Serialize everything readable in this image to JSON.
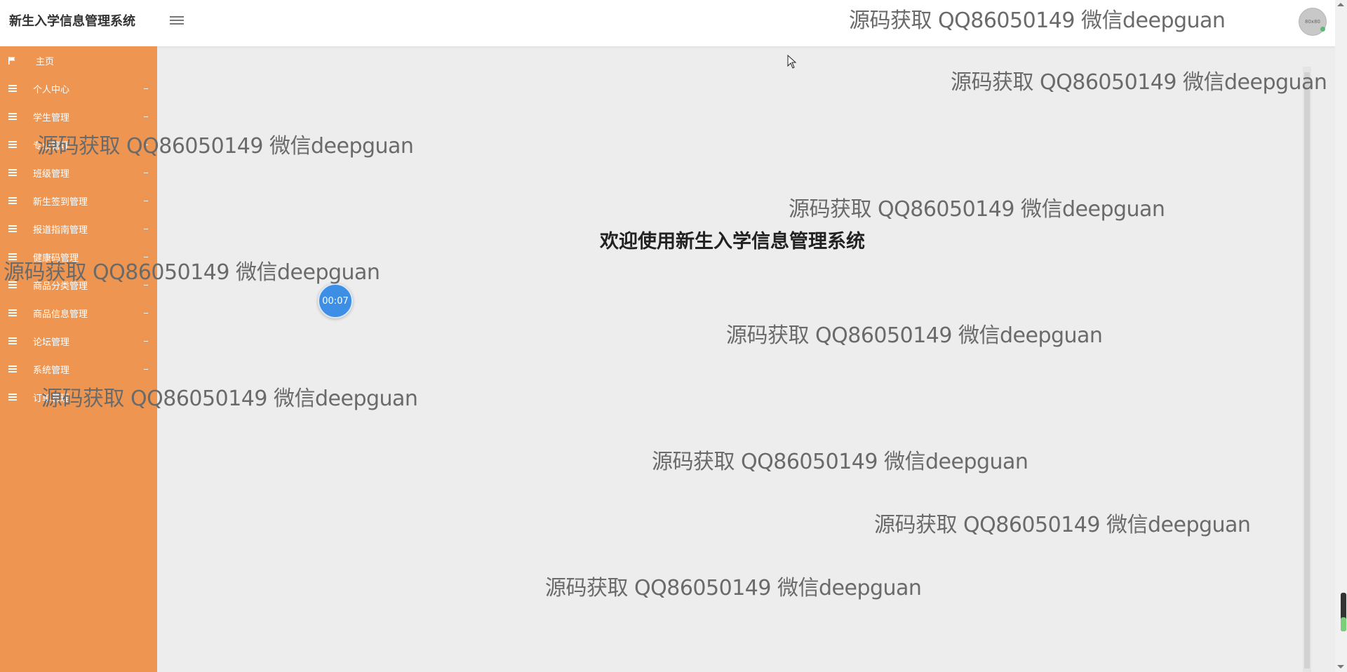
{
  "header": {
    "app_title": "新生入学信息管理系统",
    "menu_toggle_icon": "hamburger-icon",
    "avatar_text": "80x80"
  },
  "sidebar": {
    "items": [
      {
        "label": "主页",
        "icon": "flag-icon"
      },
      {
        "label": "个人中心",
        "icon": "list-icon"
      },
      {
        "label": "学生管理",
        "icon": "list-icon"
      },
      {
        "label": "专业管理",
        "icon": "list-icon"
      },
      {
        "label": "班级管理",
        "icon": "list-icon"
      },
      {
        "label": "新生签到管理",
        "icon": "list-icon"
      },
      {
        "label": "报道指南管理",
        "icon": "list-icon"
      },
      {
        "label": "健康码管理",
        "icon": "list-icon"
      },
      {
        "label": "商品分类管理",
        "icon": "list-icon"
      },
      {
        "label": "商品信息管理",
        "icon": "list-icon"
      },
      {
        "label": "论坛管理",
        "icon": "list-icon"
      },
      {
        "label": "系统管理",
        "icon": "list-icon"
      },
      {
        "label": "订单管理",
        "icon": "list-icon"
      }
    ]
  },
  "main": {
    "welcome_text": "欢迎使用新生入学信息管理系统",
    "timer_text": "00:07"
  },
  "watermark": {
    "text": "源码获取 QQ86050149 微信deepguan"
  },
  "colors": {
    "sidebar_bg": "#ee9651",
    "content_bg": "#ededed",
    "timer_bg": "#3d8fe6"
  }
}
